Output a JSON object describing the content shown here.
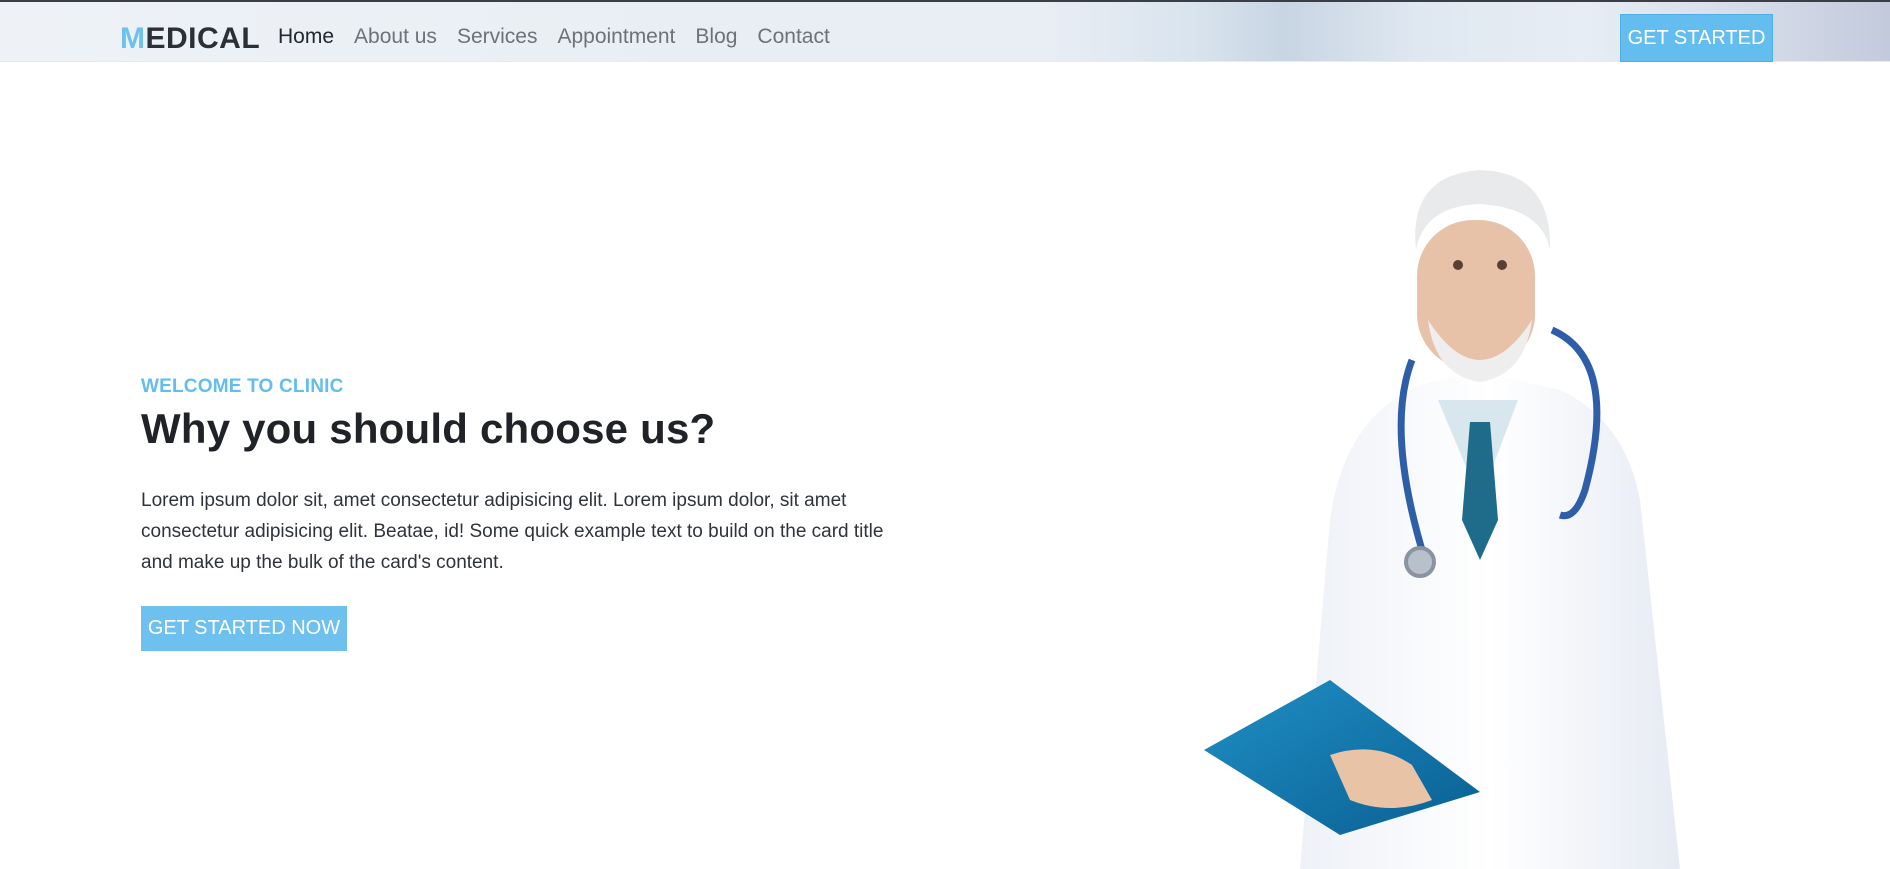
{
  "navbar": {
    "brand_first_letter": "M",
    "brand_rest": "EDICAL",
    "links": [
      {
        "label": "Home",
        "active": true
      },
      {
        "label": "About us",
        "active": false
      },
      {
        "label": "Services",
        "active": false
      },
      {
        "label": "Appointment",
        "active": false
      },
      {
        "label": "Blog",
        "active": false
      },
      {
        "label": "Contact",
        "active": false
      }
    ],
    "cta_label": "GET STARTED"
  },
  "hero": {
    "eyebrow": "WELCOME TO CLINIC",
    "title": "Why you should choose us?",
    "body": "Lorem ipsum dolor sit, amet consectetur adipisicing elit. Lorem ipsum dolor, sit amet consectetur adipisicing elit. Beatae, id! Some quick example text to build on the card title and make up the bulk of the card's content.",
    "cta_label": "GET STARTED NOW"
  },
  "colors": {
    "accent": "#63bdee",
    "text_dark": "#1f2227",
    "nav_text": "#6c727a"
  }
}
